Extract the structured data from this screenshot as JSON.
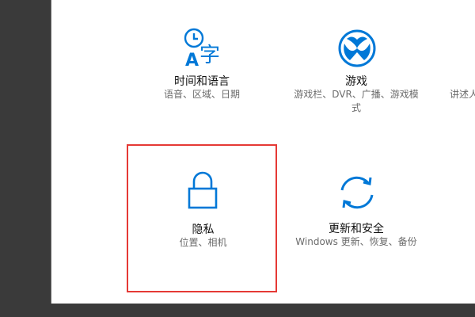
{
  "settings_tiles": [
    {
      "title": "时间和语言",
      "desc": "语音、区域、日期",
      "icon": "time-language-icon"
    },
    {
      "title": "游戏",
      "desc": "游戏栏、DVR、广播、游戏模式",
      "icon": "xbox-icon"
    },
    {
      "title": "",
      "desc": "讲述人",
      "icon": ""
    },
    {
      "title": "隐私",
      "desc": "位置、相机",
      "icon": "lock-icon"
    },
    {
      "title": "更新和安全",
      "desc": "Windows 更新、恢复、备份",
      "icon": "sync-icon"
    }
  ],
  "colors": {
    "accent": "#0078d7",
    "highlight": "#e53935",
    "panel_bg": "#ffffff",
    "frame_bg": "#3a3a3a"
  }
}
